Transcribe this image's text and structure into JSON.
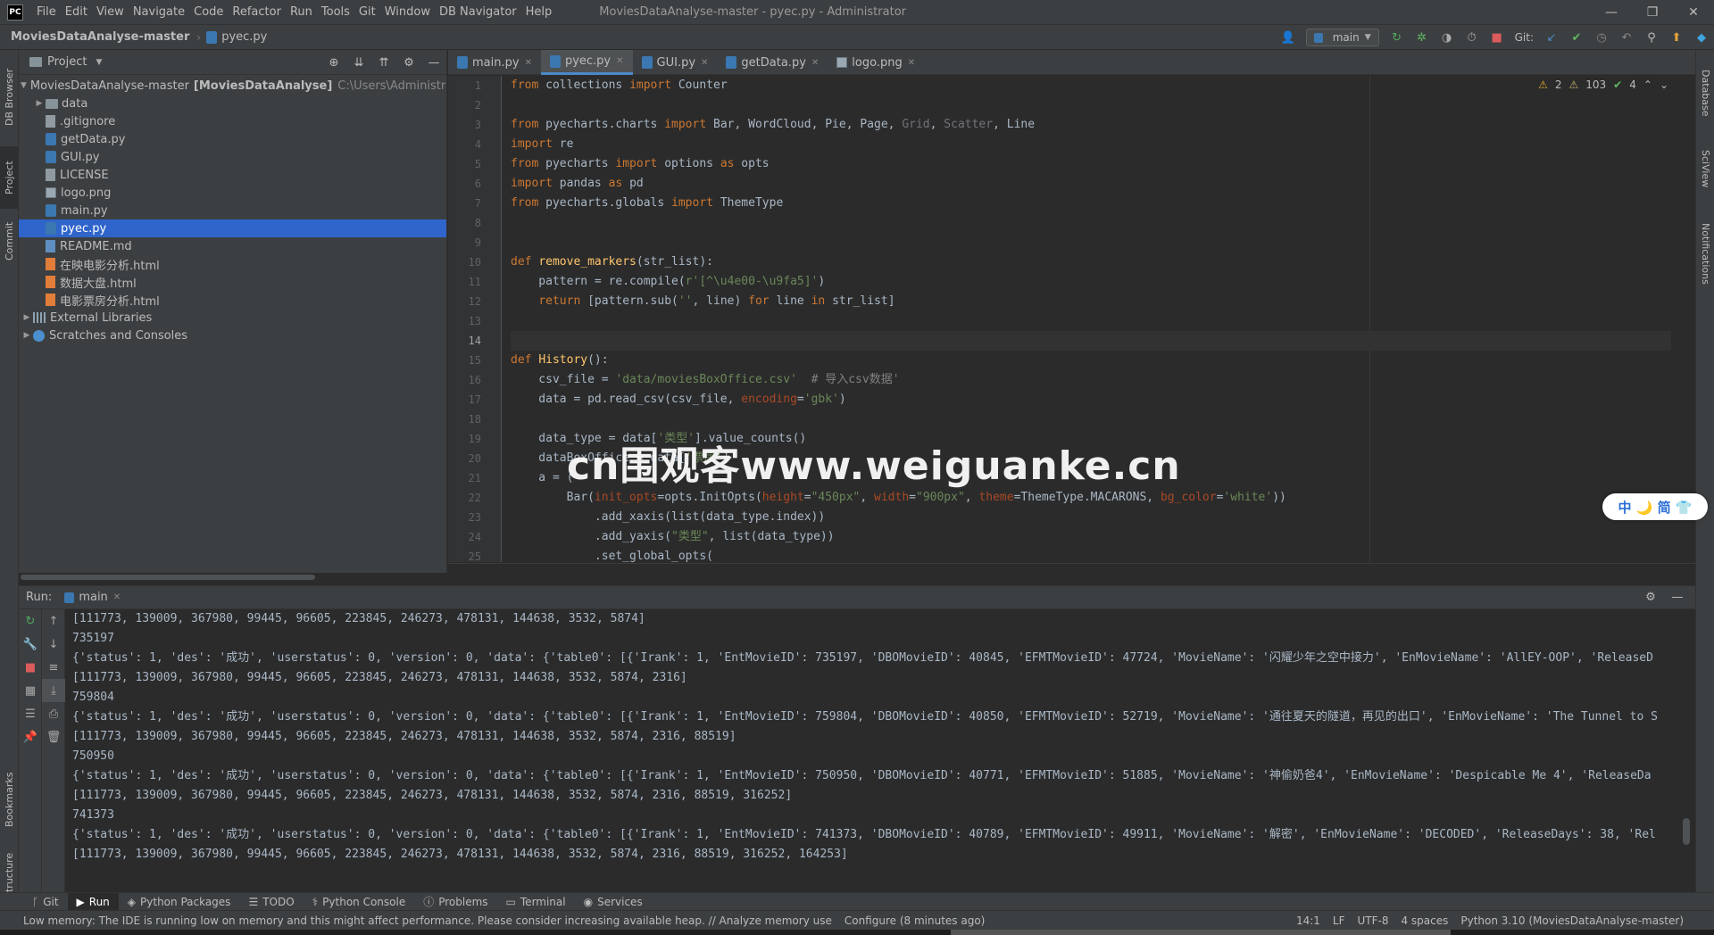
{
  "titlebar": {
    "logo": "PC",
    "menu": [
      "File",
      "Edit",
      "View",
      "Navigate",
      "Code",
      "Refactor",
      "Run",
      "Tools",
      "Git",
      "Window",
      "DB Navigator",
      "Help"
    ],
    "title": "MoviesDataAnalyse-master - pyec.py - Administrator",
    "controls": [
      "—",
      "❐",
      "✕"
    ]
  },
  "navbar": {
    "project": "MoviesDataAnalyse-master",
    "file": "pyec.py",
    "branch": "main",
    "git_label": "Git:"
  },
  "left_strip": {
    "tabs": [
      "DB Browser",
      "Project",
      "Commit",
      "Bookmarks",
      "Structure"
    ]
  },
  "right_strip": {
    "tabs": [
      "Database",
      "SciView",
      "Notifications"
    ]
  },
  "project": {
    "header": "Project",
    "root": "MoviesDataAnalyse-master",
    "root_module": "[MoviesDataAnalyse]",
    "root_path": "C:\\Users\\Administrator\\",
    "items": [
      {
        "name": "data",
        "type": "folder"
      },
      {
        "name": ".gitignore",
        "type": "txt"
      },
      {
        "name": "getData.py",
        "type": "py"
      },
      {
        "name": "GUI.py",
        "type": "py"
      },
      {
        "name": "LICENSE",
        "type": "txt"
      },
      {
        "name": "logo.png",
        "type": "img"
      },
      {
        "name": "main.py",
        "type": "py"
      },
      {
        "name": "pyec.py",
        "type": "py",
        "selected": true
      },
      {
        "name": "README.md",
        "type": "md"
      },
      {
        "name": "在映电影分析.html",
        "type": "html"
      },
      {
        "name": "数据大盘.html",
        "type": "html"
      },
      {
        "name": "电影票房分析.html",
        "type": "html"
      }
    ],
    "external": "External Libraries",
    "scratches": "Scratches and Consoles"
  },
  "editor": {
    "tabs": [
      {
        "label": "main.py",
        "active": false
      },
      {
        "label": "pyec.py",
        "active": true
      },
      {
        "label": "GUI.py",
        "active": false
      },
      {
        "label": "getData.py",
        "active": false
      },
      {
        "label": "logo.png",
        "active": false
      }
    ],
    "inspections": {
      "warn1": "2",
      "warn2": "103",
      "ok": "4"
    },
    "line_numbers": [
      "1",
      "2",
      "3",
      "4",
      "5",
      "6",
      "7",
      "8",
      "9",
      "10",
      "11",
      "12",
      "13",
      "14",
      "15",
      "16",
      "17",
      "18",
      "19",
      "20",
      "21",
      "22",
      "23",
      "24",
      "25"
    ],
    "current_line": 14
  },
  "overlays": {
    "watermark": "cn围观客www.weiguanke.cn",
    "ime": "中 🌙 简 👕"
  },
  "run": {
    "label": "Run:",
    "tab": "main",
    "output": [
      "[111773, 139009, 367980, 99445, 96605, 223845, 246273, 478131, 144638, 3532, 5874]",
      "735197",
      "{'status': 1, 'des': '成功', 'userstatus': 0, 'version': 0, 'data': {'table0': [{'Irank': 1, 'EntMovieID': 735197, 'DBOMovieID': 40845, 'EFMTMovieID': 47724, 'MovieName': '闪耀少年之空中接力', 'EnMovieName': 'AllEY-OOP', 'ReleaseD",
      "[111773, 139009, 367980, 99445, 96605, 223845, 246273, 478131, 144638, 3532, 5874, 2316]",
      "759804",
      "{'status': 1, 'des': '成功', 'userstatus': 0, 'version': 0, 'data': {'table0': [{'Irank': 1, 'EntMovieID': 759804, 'DBOMovieID': 40850, 'EFMTMovieID': 52719, 'MovieName': '通往夏天的隧道，再见的出口', 'EnMovieName': 'The Tunnel to S",
      "[111773, 139009, 367980, 99445, 96605, 223845, 246273, 478131, 144638, 3532, 5874, 2316, 88519]",
      "750950",
      "{'status': 1, 'des': '成功', 'userstatus': 0, 'version': 0, 'data': {'table0': [{'Irank': 1, 'EntMovieID': 750950, 'DBOMovieID': 40771, 'EFMTMovieID': 51885, 'MovieName': '神偷奶爸4', 'EnMovieName': 'Despicable Me 4', 'ReleaseDa",
      "[111773, 139009, 367980, 99445, 96605, 223845, 246273, 478131, 144638, 3532, 5874, 2316, 88519, 316252]",
      "741373",
      "{'status': 1, 'des': '成功', 'userstatus': 0, 'version': 0, 'data': {'table0': [{'Irank': 1, 'EntMovieID': 741373, 'DBOMovieID': 40789, 'EFMTMovieID': 49911, 'MovieName': '解密', 'EnMovieName': 'DECODED', 'ReleaseDays': 38, 'Rel",
      "[111773, 139009, 367980, 99445, 96605, 223845, 246273, 478131, 144638, 3532, 5874, 2316, 88519, 316252, 164253]"
    ]
  },
  "bottom_tabs": [
    {
      "icon": "git-icon",
      "label": "Git"
    },
    {
      "icon": "run-icon",
      "label": "Run",
      "active": true
    },
    {
      "icon": "packages-icon",
      "label": "Python Packages"
    },
    {
      "icon": "todo-icon",
      "label": "TODO"
    },
    {
      "icon": "python-console-icon",
      "label": "Python Console"
    },
    {
      "icon": "problems-icon",
      "label": "Problems"
    },
    {
      "icon": "terminal-icon",
      "label": "Terminal"
    },
    {
      "icon": "services-icon",
      "label": "Services"
    }
  ],
  "status": {
    "message": "Low memory: The IDE is running low on memory and this might affect performance. Please consider increasing available heap. // Analyze memory use",
    "config": "Configure (8 minutes ago)",
    "position": "14:1",
    "line_sep": "LF",
    "encoding": "UTF-8",
    "indent": "4 spaces",
    "interpreter": "Python 3.10 (MoviesDataAnalyse-master)"
  },
  "colors": {
    "accent": "#2f65ca",
    "bg": "#2b2b2b",
    "panel": "#3c3f41"
  }
}
